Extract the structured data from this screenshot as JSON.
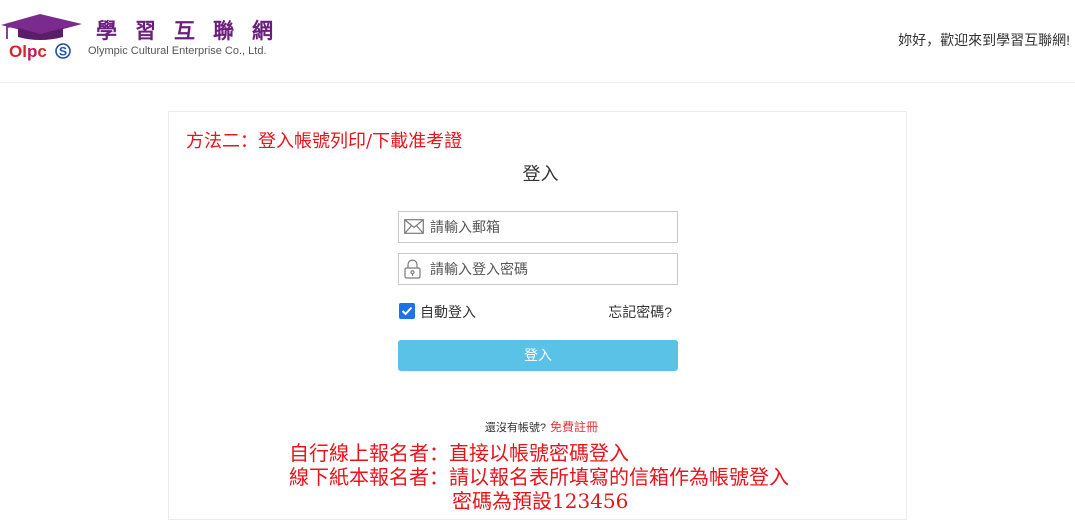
{
  "header": {
    "logo": {
      "letters": [
        "O",
        "l",
        "p",
        "c",
        "S"
      ],
      "letter_colors": [
        "#d6262b",
        "#d6262b",
        "#c2185b",
        "#d6262b",
        "#1f4fa8"
      ],
      "cap_color": "#7b2a8e"
    },
    "brand_name": "學習互聯網",
    "brand_subtitle": "Olympic Cultural Enterprise Co., Ltd.",
    "greeting": "妳好，歡迎來到學習互聯網!"
  },
  "login_panel": {
    "method_note": "方法二：登入帳號列印/下載准考證",
    "title": "登入",
    "email_field": {
      "placeholder": "請輸入郵箱",
      "icon": "envelope-icon"
    },
    "password_field": {
      "placeholder": "請輸入登入密碼",
      "icon": "lock-icon"
    },
    "remember_me": {
      "label": "自動登入",
      "checked": true
    },
    "forgot_password": "忘記密碼?",
    "submit_button": "登入",
    "register_prompt": "還沒有帳號?",
    "register_link": "免費註冊",
    "instructions": [
      "自行線上報名者：直接以帳號密碼登入",
      "線下紙本報名者：請以報名表所填寫的信箱作為帳號登入",
      "密碼為預設123456"
    ]
  },
  "colors": {
    "brand_purple": "#6b1f7c",
    "button_blue": "#5bc2e7",
    "note_red": "#e8141b",
    "link_red": "#e4393c",
    "checkbox_blue": "#1a73e8"
  }
}
